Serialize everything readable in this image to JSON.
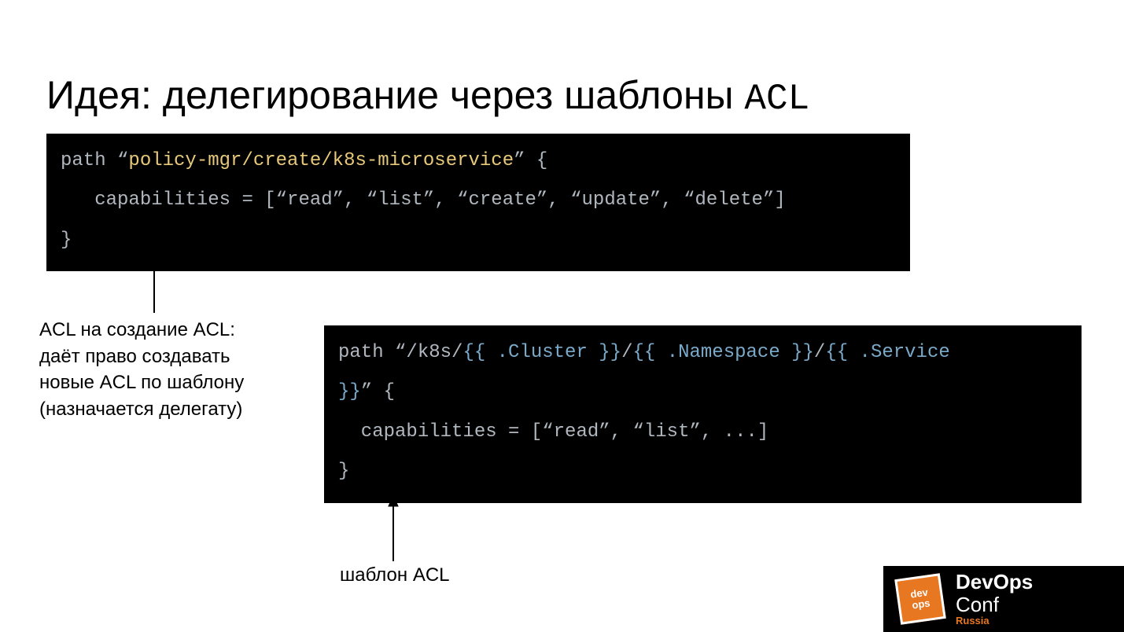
{
  "title_main": "Идея: делегирование через шаблоны ",
  "title_mono": "ACL",
  "code1": {
    "l1_kw": "path ",
    "l1_q1": "“",
    "l1_str": "policy-mgr/create/k8s-microservice",
    "l1_q2": "”",
    "l1_brace": " {",
    "l2": "   capabilities = [“read”, “list”, “create”, “update”, “delete”]",
    "l3": "}"
  },
  "annotation_left_l1": "ACL на создание ACL:",
  "annotation_left_l2": "даёт право создавать",
  "annotation_left_l3": "новые ACL по шаблону",
  "annotation_left_l4": "(назначается делегату)",
  "code2": {
    "l1_kw": "path ",
    "l1_q1": "“",
    "l1_p1": "/k8s/",
    "l1_t1": "{{ .Cluster }}",
    "l1_p2": "/",
    "l1_t2": "{{ .Namespace }}",
    "l1_p3": "/",
    "l1_t3": "{{ .Service\n}}",
    "l1_q2": "”",
    "l1_brace": " {",
    "l2": "  capabilities = [“read”, “list”, ...]",
    "l3": "}"
  },
  "annotation_bottom": "шаблон ACL",
  "logo": {
    "badge_l1": "dev",
    "badge_l2": "ops",
    "line1": "DevOps",
    "line2": "Conf",
    "line3": "Russia"
  }
}
